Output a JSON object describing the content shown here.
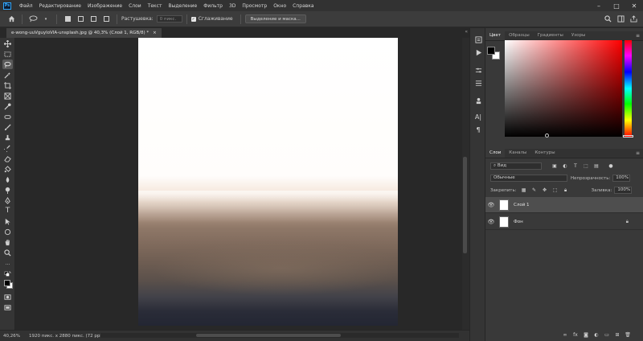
{
  "app": {
    "logo_text": "Ps"
  },
  "menubar": {
    "items": [
      "Файл",
      "Редактирование",
      "Изображение",
      "Слои",
      "Текст",
      "Выделение",
      "Фильтр",
      "3D",
      "Просмотр",
      "Окно",
      "Справка"
    ],
    "window_controls": [
      "–",
      "□",
      "✕"
    ]
  },
  "options_bar": {
    "feather_label": "Растушевка:",
    "feather_value": "0 пикс.",
    "antialias_label": "Сглаживание",
    "antialias_checked": true,
    "select_mask_button": "Выделение и маска..."
  },
  "document_tab": {
    "title": "e-wong-uuVguyloVIA-unsplash.jpg @ 40,3% (Слой 1, RGB/8) *",
    "close": "×"
  },
  "statusbar": {
    "zoom": "40,26%",
    "doc_info": "1920 пикс. x 2880 пикс. (72 ppi)",
    "arrow": ">"
  },
  "color_panel": {
    "tabs": [
      "Цвет",
      "Образцы",
      "Градиенты",
      "Узоры"
    ],
    "active_tab": "Цвет",
    "foreground": "#000000",
    "background": "#ffffff",
    "hue": "#ff0000"
  },
  "layers_panel": {
    "tabs": [
      "Слои",
      "Каналы",
      "Контуры"
    ],
    "active_tab": "Слои",
    "filter_label": "Вид",
    "blend_mode": "Обычные",
    "opacity_label": "Непрозрачность:",
    "opacity_value": "100%",
    "lock_label": "Закрепить:",
    "fill_label": "Заливка:",
    "fill_value": "100%",
    "layers": [
      {
        "name": "Слой 1",
        "selected": true,
        "locked": false
      },
      {
        "name": "Фон",
        "selected": false,
        "locked": true
      }
    ],
    "footer_icons": [
      "link-icon",
      "fx-icon",
      "mask-icon",
      "adjustment-icon",
      "group-icon",
      "new-layer-icon",
      "trash-icon"
    ]
  }
}
